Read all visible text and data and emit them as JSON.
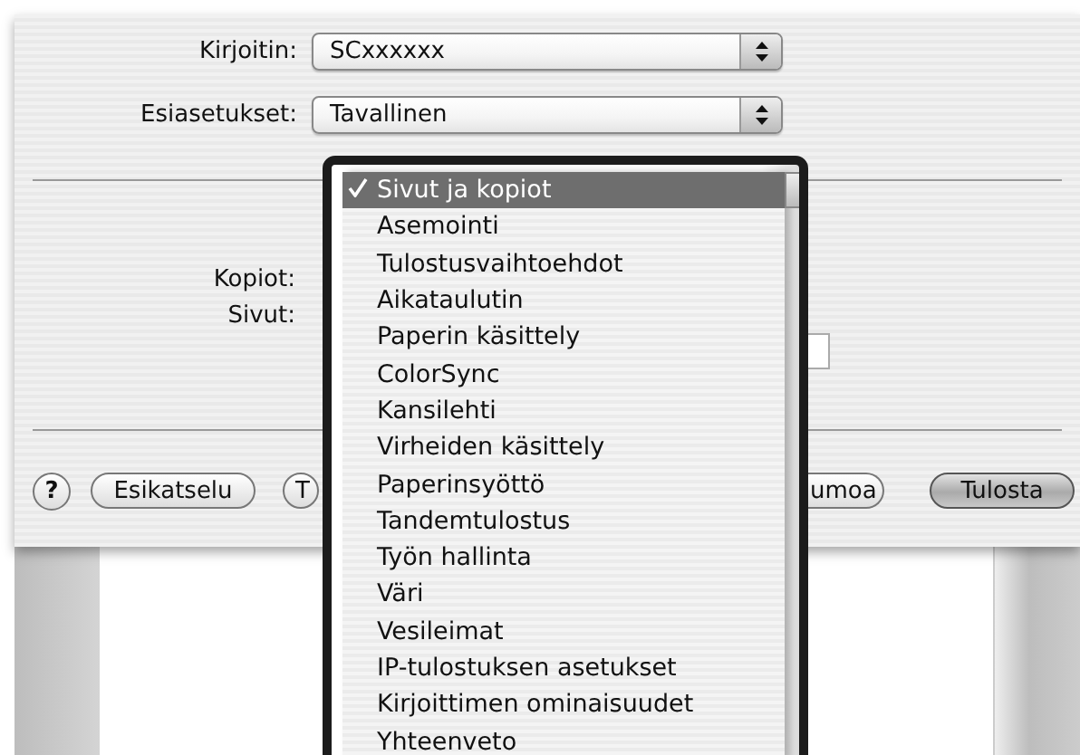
{
  "printer": {
    "label": "Kirjoitin:",
    "value": "SCxxxxxx"
  },
  "presets": {
    "label": "Esiasetukset:",
    "value": "Tavallinen"
  },
  "pages_panel": {
    "copies_label": "Kopiot:",
    "pages_label": "Sivut:"
  },
  "buttons": [
    {
      "label": "?",
      "kind": "help",
      "disabled": false,
      "default": false
    },
    {
      "label": "Esikatselu",
      "kind": "push",
      "disabled": false,
      "default": false
    },
    {
      "label": "T",
      "kind": "push",
      "disabled": false,
      "default": false
    },
    {
      "label": "umoa",
      "kind": "push",
      "disabled": false,
      "default": false
    },
    {
      "label": "Tulosta",
      "kind": "push",
      "disabled": false,
      "default": true
    }
  ],
  "menu": {
    "items": [
      {
        "label": "Sivut ja kopiot",
        "selected": true
      },
      {
        "label": "Asemointi",
        "selected": false
      },
      {
        "label": "Tulostusvaihtoehdot",
        "selected": false
      },
      {
        "label": "Aikataulutin",
        "selected": false
      },
      {
        "label": "Paperin käsittely",
        "selected": false
      },
      {
        "label": "ColorSync",
        "selected": false
      },
      {
        "label": "Kansilehti",
        "selected": false
      },
      {
        "label": "Virheiden käsittely",
        "selected": false
      },
      {
        "label": "Paperinsyöttö",
        "selected": false
      },
      {
        "label": "Tandemtulostus",
        "selected": false
      },
      {
        "label": "Työn hallinta",
        "selected": false
      },
      {
        "label": "Väri",
        "selected": false
      },
      {
        "label": "Vesileimat",
        "selected": false
      },
      {
        "label": "IP-tulostuksen asetukset",
        "selected": false
      },
      {
        "label": "Kirjoittimen ominaisuudet",
        "selected": false
      },
      {
        "label": "Yhteenveto",
        "selected": false
      }
    ]
  }
}
